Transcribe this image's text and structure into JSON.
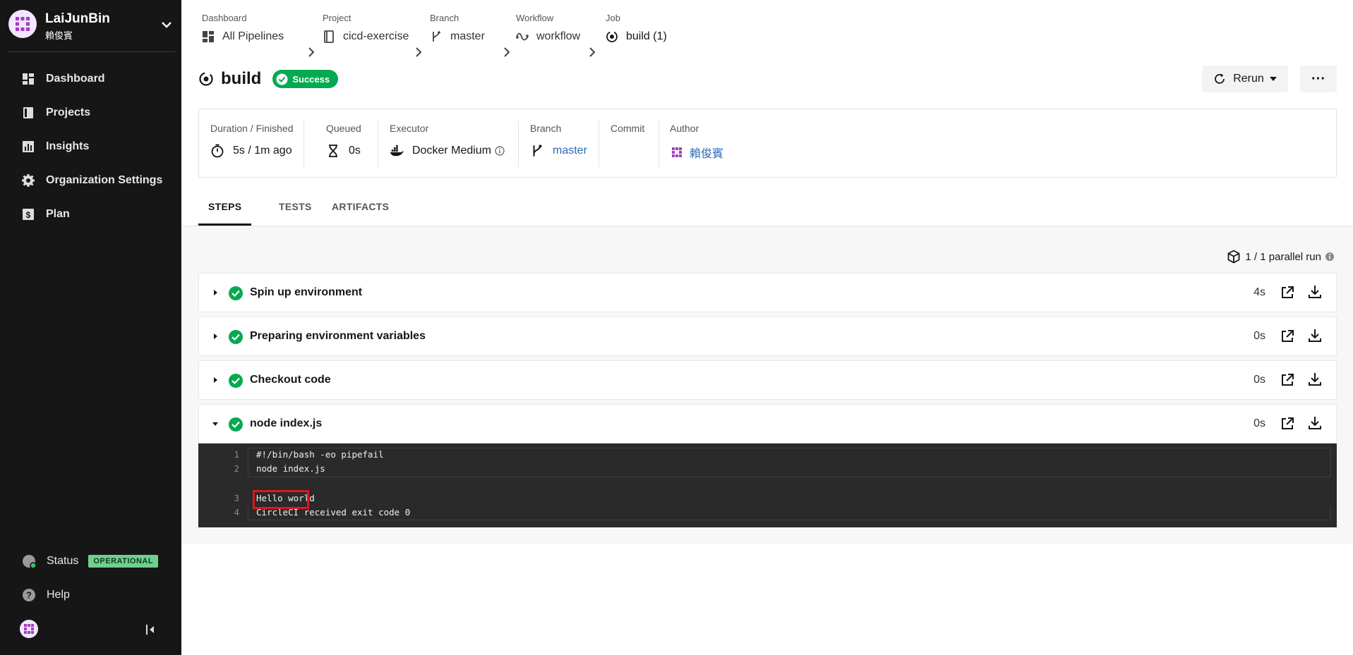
{
  "sidebar": {
    "org_name": "LaiJunBin",
    "org_sub": "賴俊賓",
    "items": [
      {
        "label": "Dashboard",
        "icon": "dashboard-icon"
      },
      {
        "label": "Projects",
        "icon": "projects-icon"
      },
      {
        "label": "Insights",
        "icon": "insights-icon"
      },
      {
        "label": "Organization Settings",
        "icon": "gear-icon"
      },
      {
        "label": "Plan",
        "icon": "plan-icon"
      }
    ],
    "status_label": "Status",
    "status_badge": "OPERATIONAL",
    "help_label": "Help"
  },
  "breadcrumb": {
    "dashboard": {
      "label": "Dashboard",
      "value": "All Pipelines"
    },
    "project": {
      "label": "Project",
      "value": "cicd-exercise"
    },
    "branch": {
      "label": "Branch",
      "value": "master"
    },
    "workflow": {
      "label": "Workflow",
      "value": "workflow"
    },
    "job": {
      "label": "Job",
      "value": "build (1)"
    }
  },
  "header": {
    "title": "build",
    "status": "Success",
    "rerun_label": "Rerun",
    "more_label": "···"
  },
  "details": {
    "duration": {
      "label": "Duration / Finished",
      "value": "5s / 1m ago"
    },
    "queued": {
      "label": "Queued",
      "value": "0s"
    },
    "executor": {
      "label": "Executor",
      "value": "Docker Medium"
    },
    "branch": {
      "label": "Branch",
      "value": "master"
    },
    "commit": {
      "label": "Commit",
      "value": ""
    },
    "author": {
      "label": "Author",
      "value": "賴俊賓"
    }
  },
  "tabs": [
    "STEPS",
    "TESTS",
    "ARTIFACTS"
  ],
  "parallel_runs": "1 / 1 parallel run",
  "steps": [
    {
      "name": "Spin up environment",
      "duration": "4s"
    },
    {
      "name": "Preparing environment variables",
      "duration": "0s"
    },
    {
      "name": "Checkout code",
      "duration": "0s"
    },
    {
      "name": "node index.js",
      "duration": "0s"
    }
  ],
  "console": [
    {
      "ln": "1",
      "text": "#!/bin/bash -eo pipefail"
    },
    {
      "ln": "2",
      "text": "node index.js"
    },
    {
      "ln": "3",
      "text": "Hello world"
    },
    {
      "ln": "4",
      "text": "CircleCI received exit code 0"
    }
  ],
  "colors": {
    "sidebar_bg": "#161616",
    "success": "#04aa51",
    "operational": "#6fd08e",
    "link": "#2a6ab8",
    "highlight": "#e0161b"
  }
}
